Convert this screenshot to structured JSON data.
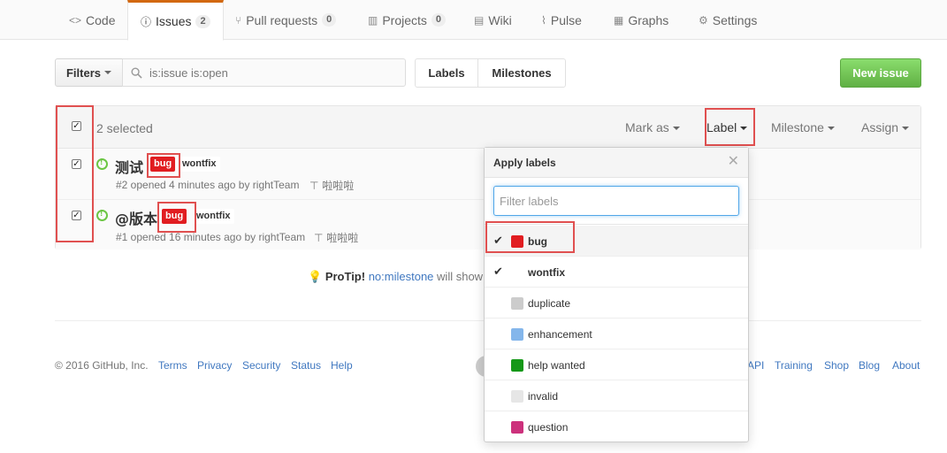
{
  "nav": {
    "tabs": [
      {
        "label": "Code",
        "icon": "code-icon"
      },
      {
        "label": "Issues",
        "count": "2",
        "icon": "issue-opened-icon"
      },
      {
        "label": "Pull requests",
        "count": "0",
        "icon": "git-pull-request-icon"
      },
      {
        "label": "Projects",
        "count": "0",
        "icon": "project-icon"
      },
      {
        "label": "Wiki",
        "icon": "book-icon"
      },
      {
        "label": "Pulse",
        "icon": "pulse-icon"
      },
      {
        "label": "Graphs",
        "icon": "graph-icon"
      },
      {
        "label": "Settings",
        "icon": "gear-icon"
      }
    ]
  },
  "subnav": {
    "filters_label": "Filters",
    "search_value": "is:issue is:open",
    "labels_label": "Labels",
    "milestones_label": "Milestones",
    "new_issue_label": "New issue"
  },
  "table_header": {
    "selected_text": "2 selected",
    "mark_as": "Mark as",
    "label": "Label",
    "milestone": "Milestone",
    "assign": "Assign"
  },
  "issues": [
    {
      "title": "测试",
      "labels": [
        "bug",
        "wontfix"
      ],
      "meta": "#2 opened 4 minutes ago by rightTeam",
      "milestone": "啦啦啦",
      "checked": true
    },
    {
      "title": "@版本",
      "labels": [
        "bug",
        "wontfix"
      ],
      "meta": "#1 opened 16 minutes ago by rightTeam",
      "milestone": "啦啦啦",
      "checked": true
    }
  ],
  "protip": {
    "prefix": "ProTip!",
    "link": "no:milestone",
    "suffix": "will show"
  },
  "footer": {
    "copyright": "© 2016 GitHub, Inc.",
    "left_links": [
      "Terms",
      "Privacy",
      "Security",
      "Status",
      "Help"
    ],
    "right_links": [
      "API",
      "Training",
      "Shop",
      "Blog",
      "About"
    ]
  },
  "label_dropdown": {
    "title": "Apply labels",
    "filter_placeholder": "Filter labels",
    "items": [
      {
        "name": "bug",
        "color": "#e11d21",
        "checked": true
      },
      {
        "name": "wontfix",
        "color": "#ffffff",
        "checked": true
      },
      {
        "name": "duplicate",
        "color": "#cccccc",
        "checked": false
      },
      {
        "name": "enhancement",
        "color": "#84b6eb",
        "checked": false
      },
      {
        "name": "help wanted",
        "color": "#159818",
        "checked": false
      },
      {
        "name": "invalid",
        "color": "#e6e6e6",
        "checked": false
      },
      {
        "name": "question",
        "color": "#cc317c",
        "checked": false
      }
    ]
  },
  "colors": {
    "accent_orange": "#d26911",
    "link_blue": "#4078c0",
    "green_button": "#60b044",
    "open_issue_green": "#6cc644",
    "highlight_red": "#e05050"
  }
}
